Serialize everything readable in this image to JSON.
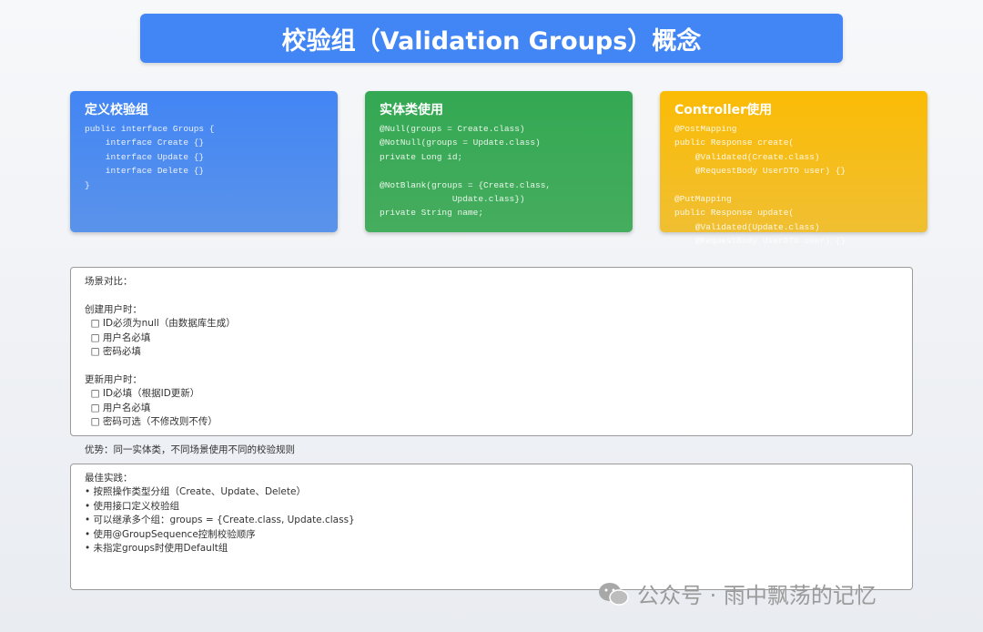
{
  "title": "校验组（Validation Groups）概念",
  "cards": [
    {
      "title": "定义校验组",
      "code": "public interface Groups {\n    interface Create {}\n    interface Update {}\n    interface Delete {}\n}",
      "color": "#4285f4"
    },
    {
      "title": "实体类使用",
      "code": "@Null(groups = Create.class)\n@NotNull(groups = Update.class)\nprivate Long id;\n\n@NotBlank(groups = {Create.class,\n              Update.class})\nprivate String name;",
      "color": "#34a853"
    },
    {
      "title": "Controller使用",
      "code": "@PostMapping\npublic Response create(\n    @Validated(Create.class)\n    @RequestBody UserDTO user) {}\n\n@PutMapping\npublic Response update(\n    @Validated(Update.class)\n    @RequestBody UserDTO user) {}",
      "color": "#fbbc05"
    }
  ],
  "scenario": "场景对比：\n\n创建用户时：\n  □ ID必须为null（由数据库生成）\n  □ 用户名必填\n  □ 密码必填\n\n更新用户时：\n  □ ID必填（根据ID更新）\n  □ 用户名必填\n  □ 密码可选（不修改则不传）",
  "advantage": "优势：同一实体类，不同场景使用不同的校验规则",
  "best_practice": "最佳实践：\n• 按照操作类型分组（Create、Update、Delete）\n• 使用接口定义校验组\n• 可以继承多个组：groups = {Create.class, Update.class}\n• 使用@GroupSequence控制校验顺序\n• 未指定groups时使用Default组",
  "watermark": "公众号 · 雨中飘荡的记忆"
}
